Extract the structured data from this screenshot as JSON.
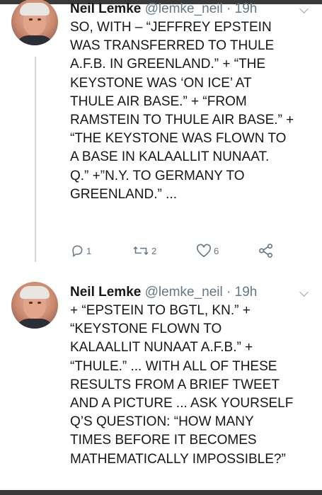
{
  "tweets": [
    {
      "name": "Neil Lemke",
      "handle": "@lemke_neil",
      "sep": "·",
      "time": "19h",
      "lines": [
        "SO, WITH – “JEFFREY EPSTEIN",
        "WAS TRANSFERRED TO THULE",
        "A.F.B. IN GREENLAND.” + “THE",
        "KEYSTONE WAS ‘ON ICE’ AT",
        "THULE AIR BASE.” + “FROM",
        "RAMSTEIN TO THULE AIR BASE.” +",
        "“THE KEYSTONE WAS FLOWN TO",
        "A BASE IN KALAALLIT NUNAAT.",
        "Q.” +”N.Y. TO GERMANY TO",
        "GREENLAND.” ..."
      ],
      "reply_count": "1",
      "retweet_count": "2",
      "like_count": "6"
    },
    {
      "name": "Neil Lemke",
      "handle": "@lemke_neil",
      "sep": "·",
      "time": "19h",
      "lines": [
        "+ “EPSTEIN TO BGTL, KN.” +",
        "“KEYSTONE FLOWN TO",
        "KALAALLIT NUNAAT A.F.B.” +",
        "“THULE.” ... WITH ALL OF THESE",
        "RESULTS FROM A BRIEF TWEET",
        "AND A PICTURE ... ASK YOURSELF",
        "Q’S QUESTION: “HOW MANY",
        "TIMES BEFORE IT BECOMES",
        "MATHEMATICALLY IMPOSSIBLE?”"
      ]
    }
  ],
  "icons": {
    "reply": "reply-icon",
    "retweet": "retweet-icon",
    "like": "heart-icon",
    "share": "share-icon",
    "caret": "chevron-down-icon"
  },
  "colors": {
    "text": "#14171a",
    "secondary": "#657786",
    "thread_line": "#cfd9de"
  }
}
